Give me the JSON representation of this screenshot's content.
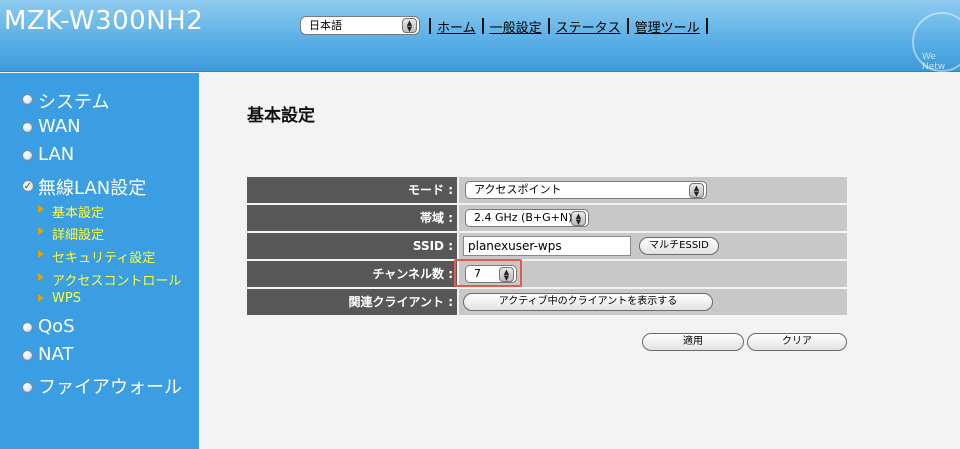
{
  "header": {
    "brand": "MZK-W300NH2",
    "language": "日本語",
    "nav": [
      "ホーム",
      "一般設定",
      "ステータス",
      "管理ツール"
    ],
    "logo_text": "We Netw"
  },
  "sidebar": {
    "items": [
      {
        "label": "システム",
        "icon": "bullet-icon"
      },
      {
        "label": "WAN",
        "icon": "bullet-icon"
      },
      {
        "label": "LAN",
        "icon": "bullet-icon"
      },
      {
        "label": "無線LAN設定",
        "icon": "check-icon",
        "active": true
      },
      {
        "label": "QoS",
        "icon": "bullet-icon"
      },
      {
        "label": "NAT",
        "icon": "bullet-icon"
      },
      {
        "label": "ファイアウォール",
        "icon": "bullet-icon"
      }
    ],
    "subitems": [
      "基本設定",
      "詳細設定",
      "セキュリティ設定",
      "アクセスコントロール",
      "WPS"
    ]
  },
  "main": {
    "title": "基本設定",
    "rows": [
      {
        "label": "モード :",
        "value": "アクセスポイント"
      },
      {
        "label": "帯域 :",
        "value": "2.4 GHz (B+G+N)"
      },
      {
        "label": "SSID :",
        "value": "planexuser-wps",
        "button": "マルチESSID"
      },
      {
        "label": "チャンネル数 :",
        "value": "7"
      },
      {
        "label": "関連クライアント :",
        "button": "アクティブ中のクライアントを表示する"
      }
    ],
    "apply_label": "適用",
    "clear_label": "クリア"
  },
  "colors": {
    "header": "#5bb0e6",
    "sidebar": "#3b9ee2",
    "sidebar_sub_text": "#ffff33",
    "label_bg": "#575757",
    "value_bg": "#c8c8c8",
    "highlight": "#e25a4f"
  }
}
